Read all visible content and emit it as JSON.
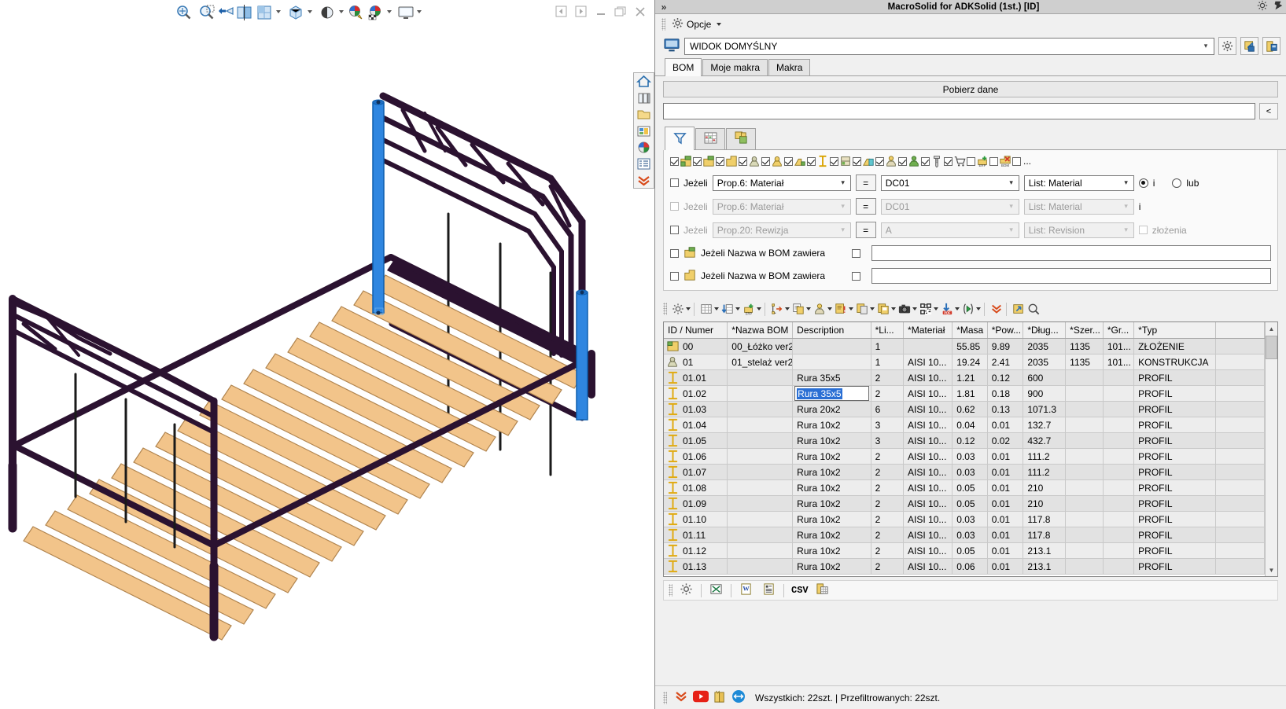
{
  "cad": {
    "toolbar_icons": [
      "zoom-fit-icon",
      "zoom-window-icon",
      "zoom-previous-icon",
      "section-view-icon",
      "render-quality-icon",
      "display-style-icon",
      "perspective-icon",
      "appearance-edit-icon",
      "appearance-texture-icon",
      "display-monitor-icon"
    ],
    "window_buttons": [
      "prev-sheet-icon",
      "next-sheet-icon",
      "minimize-icon",
      "restore-icon",
      "close-icon"
    ],
    "right_strip_icons": [
      "home-icon",
      "layers-icon",
      "folder-icon",
      "parts-library-icon",
      "globe-icon",
      "list-icon",
      "chevrons-down-icon"
    ]
  },
  "panel": {
    "titlebar": {
      "expand_label": "»",
      "title": "MacroSolid for ADKSolid (1st.) [ID]",
      "settings_icon": "gear-icon",
      "pin_icon": "pin-icon"
    },
    "options": {
      "label": "Opcje",
      "icon": "gear-icon"
    },
    "view": {
      "monitor_icon": "monitor-icon",
      "value": "WIDOK DOMYŚLNY",
      "buttons": [
        "view-settings-icon",
        "export-view-icon",
        "save-view-icon"
      ]
    },
    "tabs": [
      {
        "label": "BOM",
        "active": true
      },
      {
        "label": "Moje makra",
        "active": false
      },
      {
        "label": "Makra",
        "active": false
      }
    ],
    "get_data_button": "Pobierz dane",
    "search": {
      "value": "",
      "button_label": "<"
    },
    "subtabs": [
      {
        "icon": "filter-funnel-icon",
        "active": true
      },
      {
        "icon": "spreadsheet-icon",
        "active": false
      },
      {
        "icon": "structure-icon",
        "active": false
      }
    ],
    "type_filters": [
      {
        "icon": "assembly-green-icon",
        "checked": true
      },
      {
        "icon": "part-green-icon",
        "checked": true
      },
      {
        "icon": "part-yellow-icon",
        "checked": true
      },
      {
        "icon": "weldment-icon",
        "checked": true
      },
      {
        "icon": "weldment-yellow-icon",
        "checked": true
      },
      {
        "icon": "sheet-bend-icon",
        "checked": true
      },
      {
        "icon": "profile-beam-icon",
        "checked": true
      },
      {
        "icon": "forged-icon",
        "checked": true
      },
      {
        "icon": "sheet-cyan-icon",
        "checked": true
      },
      {
        "icon": "machined-icon",
        "checked": true
      },
      {
        "icon": "machined-green-icon",
        "checked": true
      },
      {
        "icon": "fastener-icon",
        "checked": true
      },
      {
        "icon": "cart-icon",
        "checked": true
      },
      {
        "icon": "erp-add-icon",
        "checked": false
      },
      {
        "icon": "bom-remove-icon",
        "checked": false
      },
      {
        "icon": "more-icon",
        "checked": false
      }
    ],
    "more_label": "...",
    "conditions": [
      {
        "if_label": "Jeżeli",
        "checked": false,
        "prop": "Prop.6: Materiał",
        "op": "=",
        "value": "DC01",
        "list": "List: Material",
        "enabled": true,
        "and_label": "i",
        "or_label": "lub",
        "and_selected": true
      },
      {
        "if_label": "Jeżeli",
        "checked": false,
        "prop": "Prop.6: Materiał",
        "op": "=",
        "value": "DC01",
        "list": "List: Material",
        "enabled": false,
        "and_label": "i"
      },
      {
        "if_label": "Jeżeli",
        "checked": false,
        "prop": "Prop.20: Rewizja",
        "op": "=",
        "value": "A",
        "list": "List: Revision",
        "enabled": false,
        "extra_label": "złożenia",
        "extra_checked": false
      }
    ],
    "name_filters": [
      {
        "checked": false,
        "icon": "part-green-icon",
        "label": "Jeżeli Nazwa w BOM zawiera",
        "second_checked": false,
        "value": ""
      },
      {
        "checked": false,
        "icon": "part-yellow-icon",
        "label": "Jeżeli Nazwa w BOM zawiera",
        "second_checked": false,
        "value": ""
      }
    ],
    "grid_toolbar_icons": [
      "settings-gear-icon",
      "table-view-icon",
      "sort-column-icon",
      "erp-export-icon",
      "tree-expand-icon",
      "copy-properties-icon",
      "machining-icon",
      "alert-properties-icon",
      "duplicate-icon",
      "save-properties-icon",
      "camera-icon",
      "qr-code-icon",
      "pdf-export-icon",
      "run-macro-icon",
      "chevrons-down-icon",
      "open-external-icon",
      "search-zoom-icon"
    ],
    "table": {
      "columns": [
        "ID / Numer",
        "*Nazwa BOM",
        "Description",
        "*Li...",
        "*Materiał",
        "*Masa",
        "*Pow...",
        "*Dług...",
        "*Szer...",
        "*Gr...",
        "*Typ",
        ""
      ],
      "rows": [
        {
          "icon": "assembly-icon",
          "id": "00",
          "bom_name": "00_Łóżko ver2",
          "description": "",
          "qty": "1",
          "material": "",
          "mass": "55.85",
          "area": "9.89",
          "length": "2035",
          "width": "1135",
          "thickness": "101...",
          "type": "ZŁOŻENIE"
        },
        {
          "icon": "weldment-icon",
          "id": "01",
          "bom_name": "01_stelaż ver2",
          "description": "",
          "qty": "1",
          "material": "AISI 10...",
          "mass": "19.24",
          "area": "2.41",
          "length": "2035",
          "width": "1135",
          "thickness": "101...",
          "type": "KONSTRUKCJA"
        },
        {
          "icon": "profile-icon",
          "id": "01.01",
          "bom_name": "",
          "description": "Rura 35x5",
          "qty": "2",
          "material": "AISI 10...",
          "mass": "1.21",
          "area": "0.12",
          "length": "600",
          "width": "",
          "thickness": "",
          "type": "PROFIL"
        },
        {
          "icon": "profile-icon",
          "id": "01.02",
          "bom_name": "",
          "description": "Rura 35x5",
          "qty": "2",
          "material": "AISI 10...",
          "mass": "1.81",
          "area": "0.18",
          "length": "900",
          "width": "",
          "thickness": "",
          "type": "PROFIL",
          "editing": true
        },
        {
          "icon": "profile-icon",
          "id": "01.03",
          "bom_name": "",
          "description": "Rura 20x2",
          "qty": "6",
          "material": "AISI 10...",
          "mass": "0.62",
          "area": "0.13",
          "length": "1071.3",
          "width": "",
          "thickness": "",
          "type": "PROFIL"
        },
        {
          "icon": "profile-icon",
          "id": "01.04",
          "bom_name": "",
          "description": "Rura 10x2",
          "qty": "3",
          "material": "AISI 10...",
          "mass": "0.04",
          "area": "0.01",
          "length": "132.7",
          "width": "",
          "thickness": "",
          "type": "PROFIL"
        },
        {
          "icon": "profile-icon",
          "id": "01.05",
          "bom_name": "",
          "description": "Rura 10x2",
          "qty": "3",
          "material": "AISI 10...",
          "mass": "0.12",
          "area": "0.02",
          "length": "432.7",
          "width": "",
          "thickness": "",
          "type": "PROFIL"
        },
        {
          "icon": "profile-icon",
          "id": "01.06",
          "bom_name": "",
          "description": "Rura 10x2",
          "qty": "2",
          "material": "AISI 10...",
          "mass": "0.03",
          "area": "0.01",
          "length": "111.2",
          "width": "",
          "thickness": "",
          "type": "PROFIL"
        },
        {
          "icon": "profile-icon",
          "id": "01.07",
          "bom_name": "",
          "description": "Rura 10x2",
          "qty": "2",
          "material": "AISI 10...",
          "mass": "0.03",
          "area": "0.01",
          "length": "111.2",
          "width": "",
          "thickness": "",
          "type": "PROFIL"
        },
        {
          "icon": "profile-icon",
          "id": "01.08",
          "bom_name": "",
          "description": "Rura 10x2",
          "qty": "2",
          "material": "AISI 10...",
          "mass": "0.05",
          "area": "0.01",
          "length": "210",
          "width": "",
          "thickness": "",
          "type": "PROFIL"
        },
        {
          "icon": "profile-icon",
          "id": "01.09",
          "bom_name": "",
          "description": "Rura 10x2",
          "qty": "2",
          "material": "AISI 10...",
          "mass": "0.05",
          "area": "0.01",
          "length": "210",
          "width": "",
          "thickness": "",
          "type": "PROFIL"
        },
        {
          "icon": "profile-icon",
          "id": "01.10",
          "bom_name": "",
          "description": "Rura 10x2",
          "qty": "2",
          "material": "AISI 10...",
          "mass": "0.03",
          "area": "0.01",
          "length": "117.8",
          "width": "",
          "thickness": "",
          "type": "PROFIL"
        },
        {
          "icon": "profile-icon",
          "id": "01.11",
          "bom_name": "",
          "description": "Rura 10x2",
          "qty": "2",
          "material": "AISI 10...",
          "mass": "0.03",
          "area": "0.01",
          "length": "117.8",
          "width": "",
          "thickness": "",
          "type": "PROFIL"
        },
        {
          "icon": "profile-icon",
          "id": "01.12",
          "bom_name": "",
          "description": "Rura 10x2",
          "qty": "2",
          "material": "AISI 10...",
          "mass": "0.05",
          "area": "0.01",
          "length": "213.1",
          "width": "",
          "thickness": "",
          "type": "PROFIL"
        },
        {
          "icon": "profile-icon",
          "id": "01.13",
          "bom_name": "",
          "description": "Rura 10x2",
          "qty": "2",
          "material": "AISI 10...",
          "mass": "0.06",
          "area": "0.01",
          "length": "213.1",
          "width": "",
          "thickness": "",
          "type": "PROFIL"
        }
      ],
      "editing_cell_value": "Rura 35x5"
    },
    "export_icons": [
      "settings-gear-icon",
      "excel-export-icon",
      "word-export-icon",
      "report-export-icon",
      "csv-export-icon",
      "clipboard-table-icon"
    ],
    "statusbar": {
      "icons": [
        "chevrons-down-icon",
        "youtube-icon",
        "book-icon",
        "teamviewer-icon"
      ],
      "text": "Wszystkich: 22szt. | Przefiltrowanych: 22szt."
    }
  },
  "colors": {
    "accent_blue": "#1f6fc4",
    "frame_dark": "#2b1230",
    "slat_wood": "#f2c48a",
    "panel_bg": "#f0f0f0",
    "title_bg": "#cfcfcf",
    "selection_blue": "#2a6fd4"
  }
}
